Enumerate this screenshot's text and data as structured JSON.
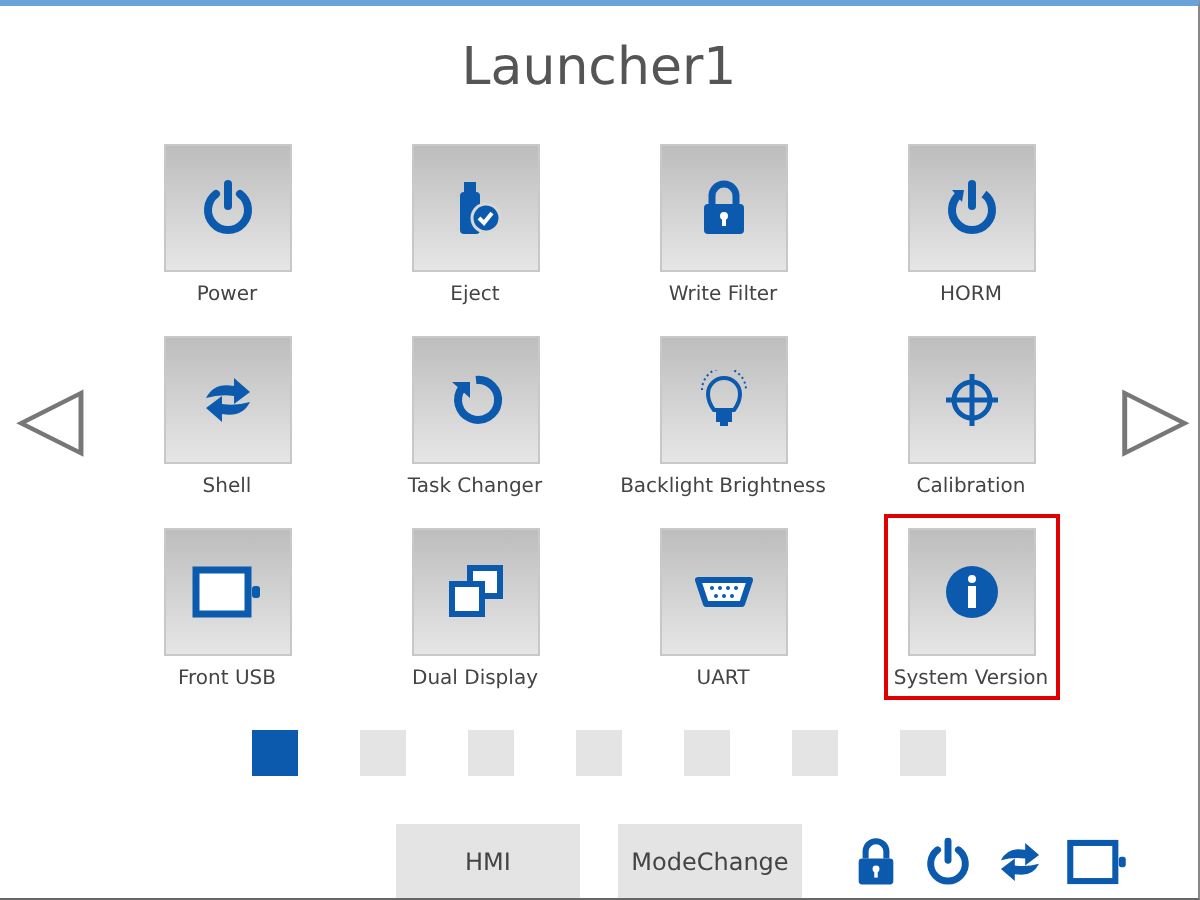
{
  "title": "Launcher1",
  "nav": {
    "previous": "◁",
    "next": "▷"
  },
  "apps": [
    {
      "label": "Power",
      "selected": false
    },
    {
      "label": "Eject",
      "selected": false
    },
    {
      "label": "Write Filter",
      "selected": false
    },
    {
      "label": "HORM",
      "selected": false
    },
    {
      "label": "Shell",
      "selected": false
    },
    {
      "label": "Task Changer",
      "selected": false
    },
    {
      "label": "Backlight Brightness",
      "selected": false
    },
    {
      "label": "Calibration",
      "selected": false
    },
    {
      "label": "Front USB",
      "selected": false
    },
    {
      "label": "Dual Display",
      "selected": false
    },
    {
      "label": "UART",
      "selected": false
    },
    {
      "label": "System Version",
      "selected": true
    }
  ],
  "pages": [
    {
      "selected": true
    },
    {
      "selected": false
    },
    {
      "selected": false
    },
    {
      "selected": false
    },
    {
      "selected": false
    },
    {
      "selected": false
    },
    {
      "selected": false
    }
  ],
  "buttons": [
    "HMI",
    "ModeChange"
  ]
}
